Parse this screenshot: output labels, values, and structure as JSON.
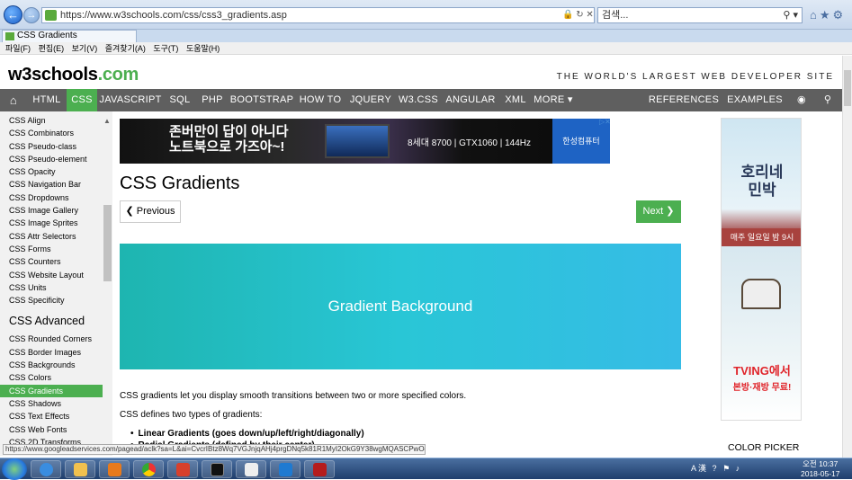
{
  "browser": {
    "url": "https://www.w3schools.com/css/css3_gradients.asp",
    "search_placeholder": "검색...",
    "tab_title": "CSS Gradients",
    "menu": [
      "파일(F)",
      "편집(E)",
      "보기(V)",
      "즐겨찾기(A)",
      "도구(T)",
      "도움말(H)"
    ]
  },
  "site": {
    "logo_prefix": "w3schools",
    "logo_suffix": ".com",
    "tagline": "THE WORLD'S LARGEST WEB DEVELOPER SITE"
  },
  "topnav": {
    "items": [
      "HTML",
      "CSS",
      "JAVASCRIPT",
      "SQL",
      "PHP",
      "BOOTSTRAP",
      "HOW TO",
      "JQUERY",
      "W3.CSS",
      "ANGULAR",
      "XML",
      "MORE ▾"
    ],
    "active": "CSS",
    "references": "REFERENCES ▾",
    "examples": "EXAMPLES ▾"
  },
  "sidebar": {
    "links_top": [
      "CSS Align",
      "CSS Combinators",
      "CSS Pseudo-class",
      "CSS Pseudo-element",
      "CSS Opacity",
      "CSS Navigation Bar",
      "CSS Dropdowns",
      "CSS Image Gallery",
      "CSS Image Sprites",
      "CSS Attr Selectors",
      "CSS Forms",
      "CSS Counters",
      "CSS Website Layout",
      "CSS Units",
      "CSS Specificity"
    ],
    "heading": "CSS Advanced",
    "links_advanced": [
      "CSS Rounded Corners",
      "CSS Border Images",
      "CSS Backgrounds",
      "CSS Colors",
      "CSS Gradients",
      "CSS Shadows",
      "CSS Text Effects",
      "CSS Web Fonts",
      "CSS 2D Transforms"
    ],
    "active": "CSS Gradients"
  },
  "ad_banner": {
    "headline_1": "존버만이 답이 아니다",
    "headline_2": "노트북으로 가즈아~!",
    "spec": "8세대 8700 | GTX1060 | 144Hz",
    "brand": "한성컴퓨터"
  },
  "main": {
    "title": "CSS Gradients",
    "prev": "❮ Previous",
    "next": "Next ❯",
    "gradient_text": "Gradient Background",
    "para1": "CSS gradients let you display smooth transitions between two or more specified colors.",
    "para2": "CSS defines two types of gradients:",
    "list": [
      "Linear Gradients (goes down/up/left/right/diagonally)",
      "Radial Gradients (defined by their center)"
    ]
  },
  "right_ad": {
    "title_1": "호리네",
    "title_2": "민박",
    "bar": "매주 일요일 밤 9시",
    "brand": "TVING에서",
    "brand2": "본방·재방 무료!"
  },
  "color_picker": "COLOR PICKER",
  "status_url": "https://www.googleadservices.com/pagead/aclk?sa=L&ai=CvcrIBtz8Wq7VGJnjqAHj4prgDNq5k81R1MyI2OkG9Y38wgMQASCPwO4iYJuD6YScK...",
  "clock": {
    "time": "오전 10:37",
    "date": "2018-05-17"
  },
  "colors": {
    "accent": "#4caf50",
    "nav": "#5f5f5f",
    "gradient_start": "#1eb5b0",
    "gradient_end": "#36bce6"
  }
}
